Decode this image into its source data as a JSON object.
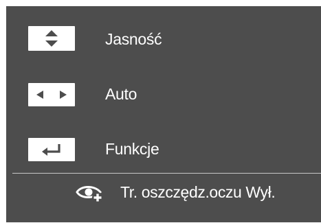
{
  "menu": {
    "items": [
      {
        "icon": "up-down-arrows-icon",
        "label": "Jasność"
      },
      {
        "icon": "left-right-arrows-icon",
        "label": "Auto"
      },
      {
        "icon": "enter-return-icon",
        "label": "Funkcje"
      }
    ]
  },
  "footer": {
    "icon": "eye-saver-icon",
    "text": "Tr. oszczędz.oczu Wył."
  },
  "colors": {
    "panel_background": "#4d4d4d",
    "text": "#ffffff",
    "icon_key_background": "#ffffff",
    "icon_glyph": "#4d4d4d"
  }
}
